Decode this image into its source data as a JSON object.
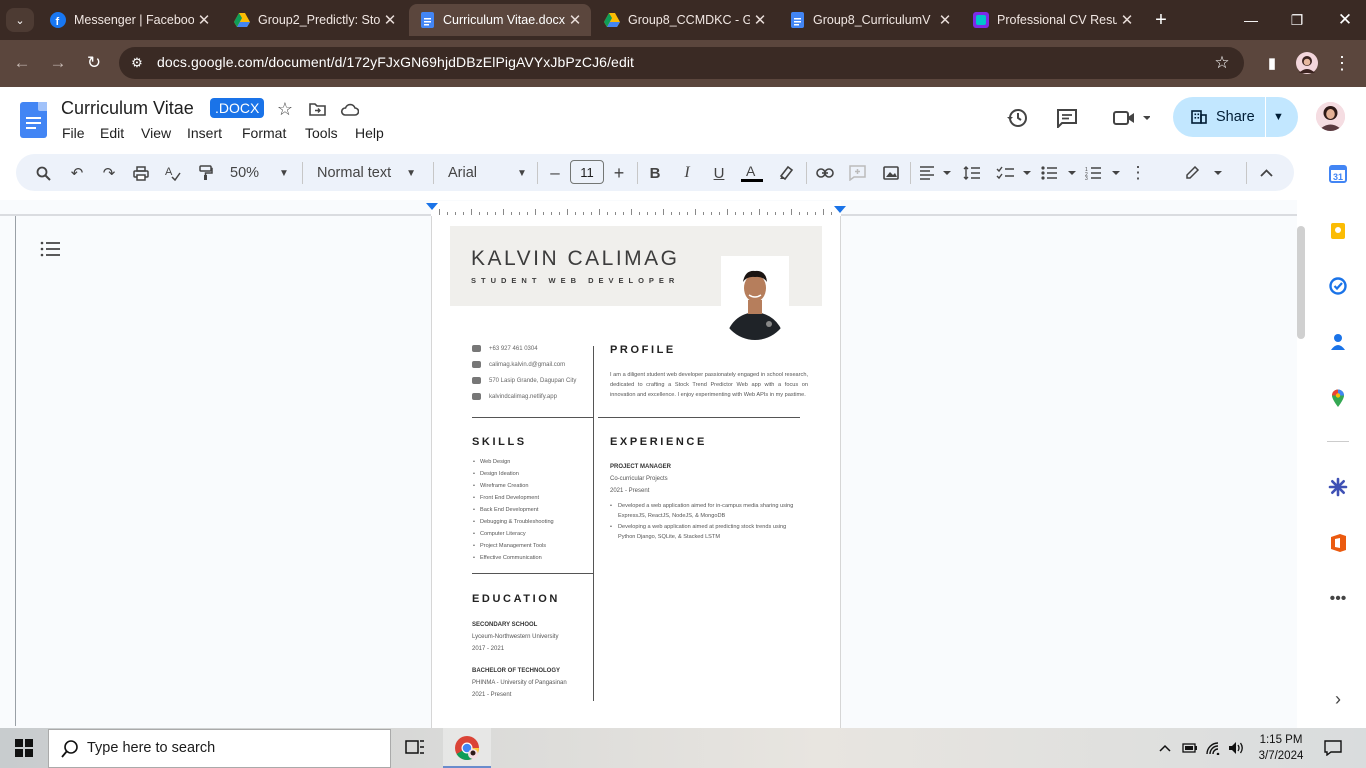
{
  "browser": {
    "tabs": [
      {
        "title": "Messenger | Facebook",
        "favicon": "facebook-icon",
        "active": false
      },
      {
        "title": "Group2_Predictly: Sto",
        "favicon": "google-drive-icon",
        "active": false
      },
      {
        "title": "Curriculum Vitae.docx",
        "favicon": "google-docs-icon",
        "active": true
      },
      {
        "title": "Group8_CCMDKC - G",
        "favicon": "google-drive-icon",
        "active": false
      },
      {
        "title": "Group8_CurriculumV",
        "favicon": "google-docs-icon",
        "active": false
      },
      {
        "title": "Professional CV Resu",
        "favicon": "canva-icon",
        "active": false
      }
    ],
    "url": "docs.google.com/document/d/172yFJxGN69hjdDBzElPigAVYxJbPzCJ6/edit"
  },
  "docs": {
    "title": "Curriculum Vitae",
    "badge": ".DOCX",
    "menu": [
      "File",
      "Edit",
      "View",
      "Insert",
      "Format",
      "Tools",
      "Help"
    ],
    "share_label": "Share",
    "toolbar": {
      "zoom": "50%",
      "style": "Normal text",
      "font": "Arial",
      "font_size": "11"
    }
  },
  "cv": {
    "name": "KALVIN CALIMAG",
    "role": "STUDENT WEB DEVELOPER",
    "contact": [
      "+63 927 461 0304",
      "calimag.kalvin.d@gmail.com",
      "570 Lasip Grande, Dagupan City",
      "kalvindcalimag.netlify.app"
    ],
    "profile_title": "PROFILE",
    "profile_text": "I am a diligent student web developer passionately engaged in school research, dedicated to crafting a Stock Trend Predictor Web app with a focus on innovation and excellence. I enjoy experimenting with Web APIs in my pastime.",
    "skills_title": "SKILLS",
    "skills": [
      "Web Design",
      "Design Ideation",
      "Wireframe Creation",
      "Front End Development",
      "Back End Development",
      "Debugging & Troubleshooting",
      "Computer Literacy",
      "Project Management Tools",
      "Effective Communication"
    ],
    "experience_title": "EXPERIENCE",
    "job_title": "PROJECT MANAGER",
    "job_org": "Co-curricular Projects",
    "job_period": "2021 - Present",
    "job_bullets": [
      "Developed a web application aimed for in-campus media sharing using ExpressJS, ReactJS, NodeJS, & MongoDB",
      "Developing a web application aimed at predicting stock trends using Python Django, SQLite, & Stacked LSTM"
    ],
    "education_title": "EDUCATION",
    "education": [
      {
        "level": "SECONDARY SCHOOL",
        "school": "Lyceum-Northwestern University",
        "years": "2017 - 2021"
      },
      {
        "level": "BACHELOR OF TECHNOLOGY",
        "school": "PHINMA - University of Pangasinan",
        "years": "2021 - Present"
      }
    ]
  },
  "taskbar": {
    "search_placeholder": "Type here to search",
    "time": "1:15 PM",
    "date": "3/7/2024"
  },
  "colors": {
    "accent": "#1a73e8",
    "share_bg": "#c2e7ff",
    "tab_strip": "#3a2a24",
    "toolbar": "#5b463d"
  }
}
